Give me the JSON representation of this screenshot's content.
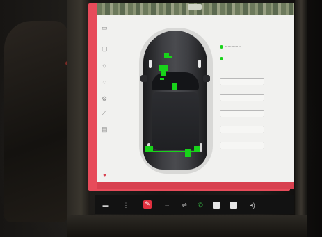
{
  "colors": {
    "accent_red": "#e74b5a",
    "marker_green": "#18d31a",
    "panel_bg": "#f1f1ef",
    "car_body": "#3d3e42",
    "taskbar_bg": "#121212"
  },
  "icons": {
    "sidebar": [
      "car-icon",
      "lock-icon",
      "light-icon",
      "settings-icon",
      "wrench-icon",
      "service-icon",
      "alert-icon"
    ],
    "taskbar": [
      "car-icon",
      "temperature-icon",
      "wrench-icon",
      "fan-icon",
      "seat-icon",
      "phone-icon",
      "media-icon",
      "app-icon",
      "volume-icon"
    ]
  },
  "legend": [
    {
      "text": "ꞏꞏ ꞏꞏꞏꞏ ꞏꞏ ꞏꞏꞏꞏ ꞏꞏ"
    },
    {
      "text": "ꞏꞏꞏꞏ ꞏꞏꞏꞏꞏ ꞏꞏ ꞏꞏꞏꞏ"
    }
  ],
  "buttons": [
    {
      "label": ""
    },
    {
      "label": ""
    },
    {
      "label": ""
    },
    {
      "label": ""
    },
    {
      "label": ""
    }
  ],
  "status_bar": {
    "text": ""
  }
}
